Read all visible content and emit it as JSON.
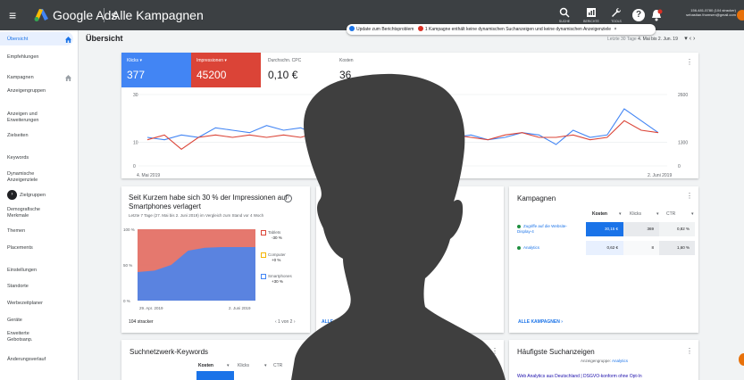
{
  "topbar": {
    "menu_glyph": "≡",
    "brand": "Google Ads",
    "title": "Alle Kampagnen",
    "tools": [
      {
        "icon": "search-icon",
        "label": "SUCHE"
      },
      {
        "icon": "report-icon",
        "label": "BERICHTE"
      },
      {
        "icon": "tools-icon",
        "label": "TOOLS"
      }
    ],
    "help_glyph": "?",
    "account_id": "156-481-5780 (104 stracker)",
    "account_email": "sebastian.thomsen@gmail.com"
  },
  "notification": {
    "item1": "Update zum Berichtsproblem",
    "item2": "1 Kampagne enthält keine dynamischen Suchanzeigen und keine dynamischen Anzeigenziele",
    "close": "×"
  },
  "sidebar": {
    "items": [
      {
        "label": "Übersicht"
      },
      {
        "label": "Empfehlungen"
      },
      {
        "label": "Kampagnen"
      },
      {
        "label": "Anzeigengruppen"
      },
      {
        "label": "Anzeigen und Erweiterungen"
      },
      {
        "label": "Zielseiten"
      },
      {
        "label": "Keywords"
      },
      {
        "label": "Dynamische Anzeigenziele"
      },
      {
        "label": "Zielgruppen"
      },
      {
        "label": "Demografische Merkmale"
      },
      {
        "label": "Themen"
      },
      {
        "label": "Placements"
      },
      {
        "label": "Einstellungen"
      },
      {
        "label": "Standorte"
      },
      {
        "label": "Werbezeitplaner"
      },
      {
        "label": "Geräte"
      },
      {
        "label": "Erweiterte Gebotsanp."
      },
      {
        "label": "Änderungsverlauf"
      }
    ],
    "collapse_glyph": "›"
  },
  "header": {
    "page_title": "Übersicht",
    "date_range_label": "Letzte 30 Tage",
    "date_range_value": "4. Mai bis 2. Jun.",
    "date_range_year": "19",
    "nav": "▾   ‹   ›"
  },
  "metrics": [
    {
      "label": "Klicks ▾",
      "value": "377",
      "color": "#4285f4"
    },
    {
      "label": "Impressionen ▾",
      "value": "45200",
      "color": "#db4437"
    },
    {
      "label": "Durchschn. CPC",
      "value": "0,10 €"
    },
    {
      "label": "Kosten",
      "value": "36"
    }
  ],
  "chart_data": [
    {
      "type": "line",
      "x_start": "4. Mai 2019",
      "x_end": "2. Juni 2019",
      "ylim_left": [
        0,
        30
      ],
      "ylim_right": [
        0,
        2600
      ],
      "left_ticks": [
        "30",
        "10",
        "0"
      ],
      "right_ticks": [
        "2600",
        "1300",
        "0"
      ],
      "series": [
        {
          "color": "#4285f4",
          "values": [
            12,
            11,
            13,
            12,
            16,
            15,
            14,
            17,
            15,
            16,
            13,
            17,
            15,
            8,
            14,
            13,
            12,
            13,
            12,
            13,
            11,
            12,
            14,
            13,
            9,
            15,
            12,
            13,
            24,
            19,
            14
          ]
        },
        {
          "color": "#db4437",
          "values": [
            11,
            13,
            7,
            12,
            13,
            12,
            13,
            12,
            13,
            12,
            14,
            11,
            12,
            12,
            13,
            12,
            11,
            12,
            13,
            12,
            11,
            13,
            14,
            12,
            12,
            13,
            11,
            12,
            19,
            15,
            14
          ]
        }
      ]
    },
    {
      "type": "area",
      "title": "Seit Kurzem habe sich 30 % der Impressionen auf Smartphones verlagert",
      "x_start": "29. Apr. 2019",
      "x_end": "2. Juni 2019",
      "ylim": [
        0,
        100
      ],
      "y_ticks": [
        "100 %",
        "50 %",
        "0 %"
      ],
      "series": [
        {
          "name": "Tablets",
          "color": "#e06055",
          "change": "-30 %"
        },
        {
          "name": "Computer",
          "color": "#f4b400",
          "change": "+0 %"
        },
        {
          "name": "Smartphones",
          "color": "#4285f4",
          "change": "+30 %"
        }
      ],
      "smartphone_share": [
        40,
        42,
        50,
        70,
        74,
        75,
        75,
        75
      ]
    }
  ],
  "smartphone_card": {
    "title": "Seit Kurzem habe sich 30 % der Impressionen auf Smartphones verlagert",
    "subtitle": "Letzte 7 Tage (27. Mai bis 2. Juni 2019) im Vergleich zum Stand vor 4 Woch",
    "footer": "104 stracker",
    "pager": "‹  1 von 2  ›",
    "help_glyph": "?"
  },
  "campaigns_card": {
    "title": "Kampagnen",
    "columns": [
      "Kosten",
      "Klicks",
      "CTR"
    ],
    "rows": [
      {
        "name": "Zugriffe auf die Website-Display-4",
        "cost": "30,15 €",
        "clicks": "369",
        "ctr": "0,82 %"
      },
      {
        "name": "Analytics",
        "cost": "0,62 €",
        "clicks": "8",
        "ctr": "1,60 %"
      }
    ],
    "link": "ALLE KAMPAGNEN  ›"
  },
  "middle_link": "ALLE",
  "keywords_card": {
    "title": "Suchnetzwerk-Keywords",
    "columns": [
      "Kosten",
      "Klicks",
      "CTR"
    ]
  },
  "search_ads_card": {
    "title": "Häufigste Suchanzeigen",
    "subtitle_label": "Anzeigengruppe:",
    "subtitle_value": "Analytics",
    "ad_link": "Web Analytics aus Deutschland | DSGVO-konform ohne Opt-In"
  },
  "middle_bottom_title": "Su"
}
